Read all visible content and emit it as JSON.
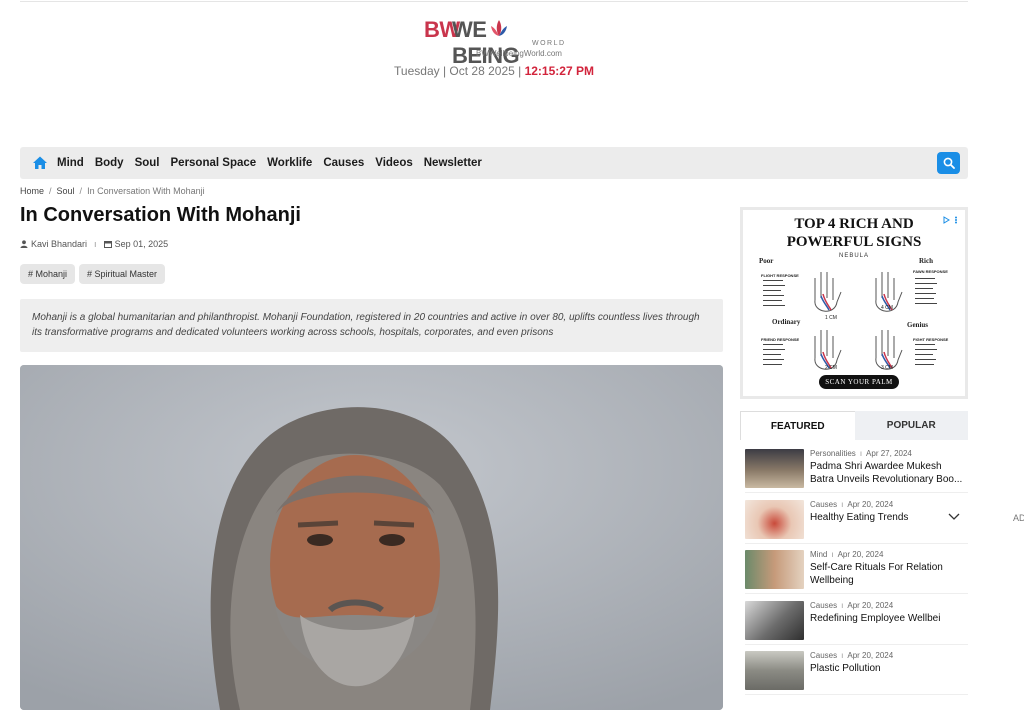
{
  "brand": {
    "logo_bw": "BW",
    "logo_rest": "WELLBEING",
    "logo_world": "WORLD",
    "site": "BWWellbeingWorld.com",
    "colors": {
      "primary": "#c9354c",
      "accent": "#1a8ee6"
    }
  },
  "dateline": {
    "date": "Tuesday | Oct 28 2025 | ",
    "time": "12:15:27 PM"
  },
  "nav": {
    "home_icon": "home-icon",
    "items": [
      "Mind",
      "Body",
      "Soul",
      "Personal Space",
      "Worklife",
      "Causes",
      "Videos",
      "Newsletter"
    ],
    "search_icon": "search-icon"
  },
  "breadcrumb": {
    "home": "Home",
    "section": "Soul",
    "current": "In Conversation With Mohanji"
  },
  "article": {
    "title": "In Conversation With Mohanji",
    "author": "Kavi Bhandari",
    "date": "Sep 01, 2025",
    "tags": [
      "# Mohanji",
      "# Spiritual Master"
    ],
    "summary": "Mohanji is a global humanitarian and philanthropist. Mohanji Foundation, registered in 20 countries and active in over 80, uplifts countless lives through its transformative programs and dedicated volunteers working across schools, hospitals, corporates, and even prisons"
  },
  "ad": {
    "title_line1": "TOP 4 RICH AND",
    "title_line2": "POWERFUL SIGNS",
    "brand": "NEBULA",
    "labels": [
      "Poor",
      "Rich",
      "Ordinary",
      "Genius"
    ],
    "responses": [
      "FLIGHT RESPONSE",
      "FAWN RESPONSE",
      "FRIEND RESPONSE",
      "FIGHT RESPONSE"
    ],
    "sizes": [
      "1 CM",
      "4 CM",
      "2 CM",
      "3 CM"
    ],
    "cta": "SCAN YOUR PALM"
  },
  "sidebar": {
    "tabs": [
      "FEATURED",
      "POPULAR"
    ],
    "items": [
      {
        "category": "Personalities",
        "date": "Apr 27, 2024",
        "title": "Padma Shri Awardee Mukesh Batra Unveils Revolutionary Boo...",
        "thumb_color": "#7a6a5a"
      },
      {
        "category": "Causes",
        "date": "Apr 20, 2024",
        "title": "Healthy Eating Trends",
        "thumb_color": "#d9b9a6"
      },
      {
        "category": "Mind",
        "date": "Apr 20, 2024",
        "title": "Self-Care Rituals For Relation Wellbeing",
        "thumb_color": "#b78b6f"
      },
      {
        "category": "Causes",
        "date": "Apr 20, 2024",
        "title": "Redefining Employee Wellbei",
        "thumb_color": "#8c8c8c"
      },
      {
        "category": "Causes",
        "date": "Apr 20, 2024",
        "title": "Plastic Pollution",
        "thumb_color": "#9a9a94"
      }
    ]
  },
  "floating_ad": {
    "label": "AD"
  }
}
